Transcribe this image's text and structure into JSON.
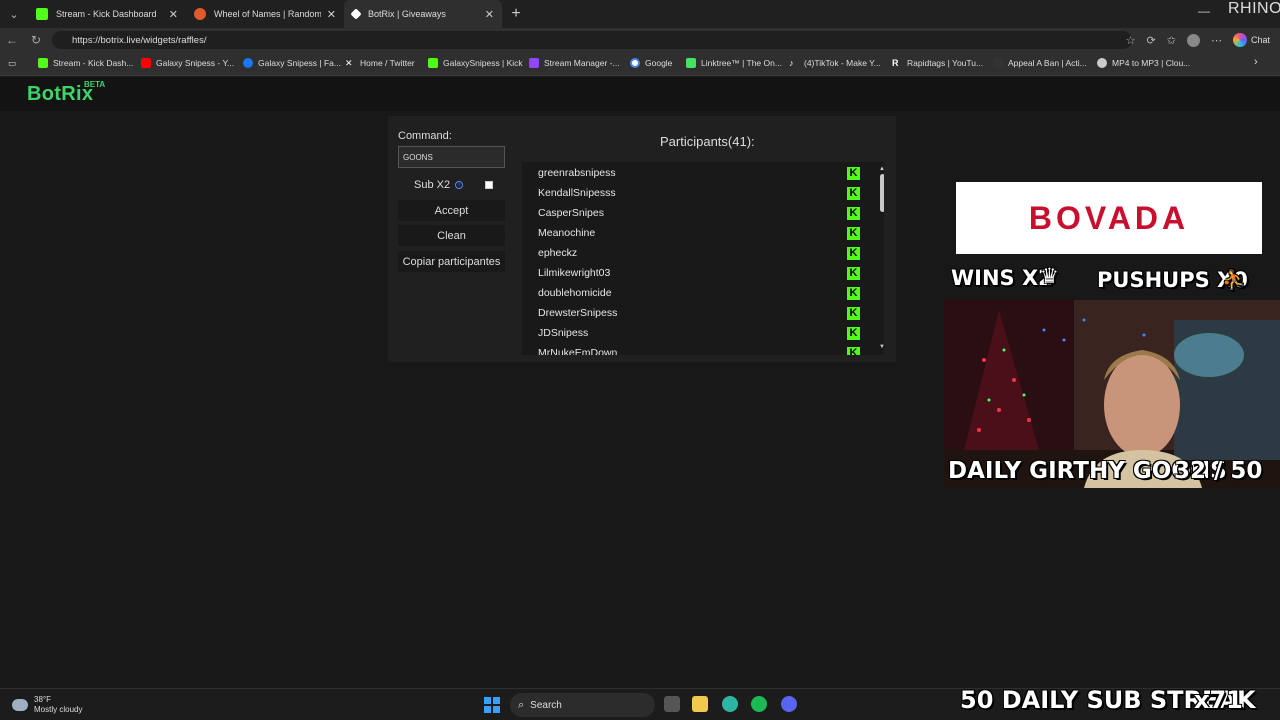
{
  "browser": {
    "tabs": [
      {
        "title": "Stream - Kick Dashboard",
        "color": "#53fc18"
      },
      {
        "title": "Wheel of Names | Random name p",
        "color": "#e05a2a"
      },
      {
        "title": "BotRix | Giveaways",
        "color": "#ffffff"
      }
    ],
    "url": "https://botrix.live/widgets/raffles/",
    "chat_label": "Chat",
    "corner_text": "RHINO",
    "bookmarks": [
      {
        "label": "Stream - Kick Dash...",
        "color": "#53fc18"
      },
      {
        "label": "Galaxy Snipess - Y...",
        "color": "#ff0000"
      },
      {
        "label": "Galaxy Snipess | Fa...",
        "color": "#1877f2"
      },
      {
        "label": "Home / Twitter",
        "color": "#ffffff"
      },
      {
        "label": "GalaxySnipess | Kick",
        "color": "#53fc18"
      },
      {
        "label": "Stream Manager -...",
        "color": "#9146ff"
      },
      {
        "label": "Google",
        "color": "#4285f4"
      },
      {
        "label": "Linktree™ | The On...",
        "color": "#43e55e"
      },
      {
        "label": "(4)TikTok - Make Y...",
        "color": "#ffffff"
      },
      {
        "label": "Rapidtags | YouTu...",
        "color": "#ffffff"
      },
      {
        "label": "Appeal A Ban | Acti...",
        "color": "#333333"
      },
      {
        "label": "MP4 to MP3 | Clou...",
        "color": "#cccccc"
      }
    ]
  },
  "botrix": {
    "logo": "BotRix",
    "beta": "BETA",
    "command_label": "Command:",
    "command_value": "GOONS",
    "sub_x2_label": "Sub X2",
    "accept": "Accept",
    "clean": "Clean",
    "copy": "Copiar participantes",
    "participants_title": "Participants(41):",
    "participants": [
      "greenrabsnipess",
      "KendallSnipesss",
      "CasperSnipes",
      "Meanochine",
      "epheckz",
      "Lilmikewright03",
      "doublehomicide",
      "DrewsterSnipess",
      "JDSnipess",
      "MrNukeEmDown"
    ],
    "platform_badge": "K"
  },
  "overlay": {
    "sponsor": "BOVADA",
    "wins": "WINS X2",
    "pushups": "PUSHUPS X0",
    "daily_goons": "DAILY GIRTHY GOONS",
    "goons_count": "32 / 50",
    "sub_streak": "50 DAILY SUB STREAK",
    "sub_streak_mult": "x71"
  },
  "taskbar": {
    "temperature": "38°F",
    "condition": "Mostly cloudy",
    "search": "Search"
  }
}
